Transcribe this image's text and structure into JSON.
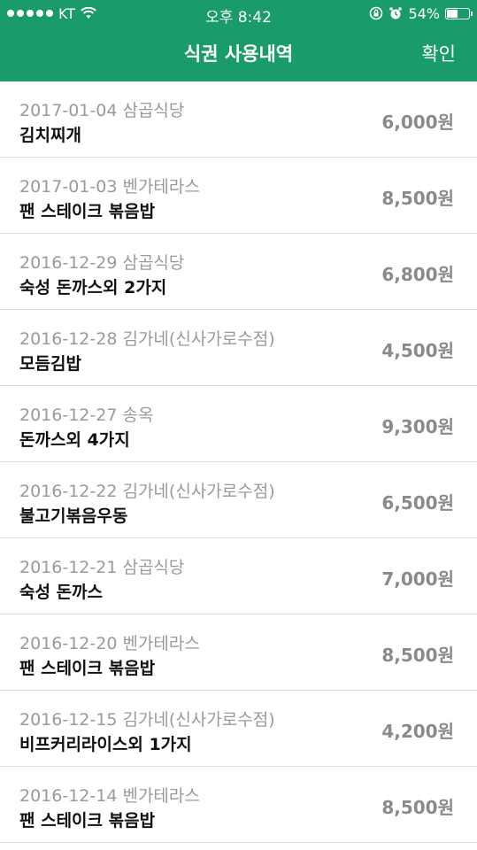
{
  "status_bar": {
    "carrier": "KT",
    "time": "오후 8:42",
    "battery_percent": "54%",
    "battery_level": 0.54
  },
  "header": {
    "title": "식권 사용내역",
    "confirm_label": "확인",
    "accent_color": "#1a9b6a"
  },
  "transactions": [
    {
      "date": "2017-01-04",
      "place": "삼곱식당",
      "item": "김치찌개",
      "amount": "6,000원"
    },
    {
      "date": "2017-01-03",
      "place": "벤가테라스",
      "item": "팬 스테이크 볶음밥",
      "amount": "8,500원"
    },
    {
      "date": "2016-12-29",
      "place": "삼곱식당",
      "item": "숙성 돈까스외 2가지",
      "amount": "6,800원"
    },
    {
      "date": "2016-12-28",
      "place": "김가네(신사가로수점)",
      "item": "모듬김밥",
      "amount": "4,500원"
    },
    {
      "date": "2016-12-27",
      "place": "송옥",
      "item": "돈까스외 4가지",
      "amount": "9,300원"
    },
    {
      "date": "2016-12-22",
      "place": "김가네(신사가로수점)",
      "item": "불고기볶음우동",
      "amount": "6,500원"
    },
    {
      "date": "2016-12-21",
      "place": "삼곱식당",
      "item": "숙성 돈까스",
      "amount": "7,000원"
    },
    {
      "date": "2016-12-20",
      "place": "벤가테라스",
      "item": "팬 스테이크 볶음밥",
      "amount": "8,500원"
    },
    {
      "date": "2016-12-15",
      "place": "김가네(신사가로수점)",
      "item": "비프커리라이스외 1가지",
      "amount": "4,200원"
    },
    {
      "date": "2016-12-14",
      "place": "벤가테라스",
      "item": "팬 스테이크 볶음밥",
      "amount": "8,500원"
    }
  ]
}
